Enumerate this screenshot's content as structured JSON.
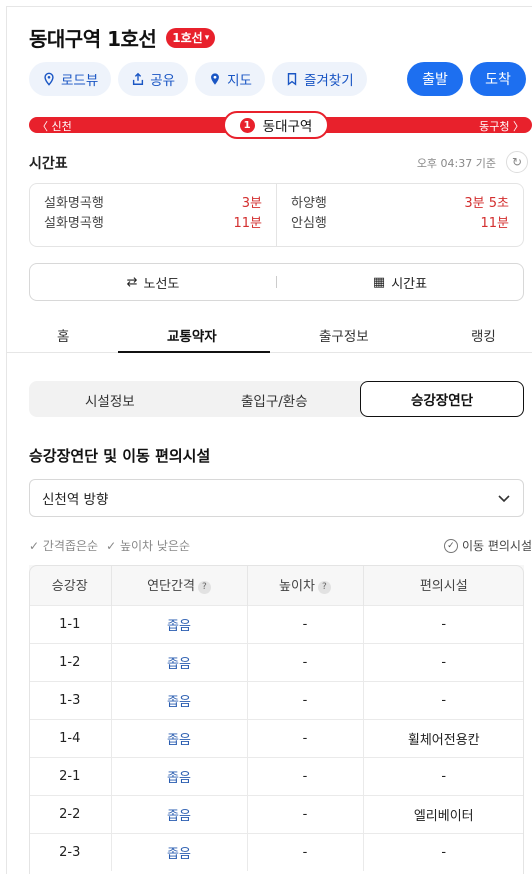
{
  "header": {
    "title": "동대구역 1호선",
    "line_chip": "1호선"
  },
  "actions": {
    "roadview": "로드뷰",
    "share": "공유",
    "map": "지도",
    "favorite": "즐겨찾기",
    "depart": "출발",
    "arrive": "도착"
  },
  "line_bar": {
    "prev": "〈 신천",
    "next": "동구청 〉",
    "line_number": "1",
    "station": "동대구역",
    "color": "#e8212c"
  },
  "timetable": {
    "heading": "시간표",
    "updated": "오후 04:37 기준",
    "left": [
      {
        "dest": "설화명곡행",
        "min": "3분"
      },
      {
        "dest": "설화명곡행",
        "min": "11분"
      }
    ],
    "right": [
      {
        "dest": "하양행",
        "min": "3분 5초"
      },
      {
        "dest": "안심행",
        "min": "11분"
      }
    ],
    "route_map": "노선도",
    "timetable_button": "시간표"
  },
  "main_tabs": [
    "홈",
    "교통약자",
    "출구정보",
    "랭킹"
  ],
  "sub_tabs": [
    "시설정보",
    "출입구/환승",
    "승강장연단"
  ],
  "section": {
    "title": "승강장연단 및 이동 편의시설",
    "direction": "신천역 방향",
    "filter_narrow": "간격좁은순",
    "filter_height": "높이차 낮은순",
    "legend": "이동 편의시설"
  },
  "table": {
    "headers": [
      "승강장",
      "연단간격",
      "높이차",
      "편의시설"
    ],
    "rows": [
      [
        "1-1",
        "좁음",
        "-",
        "-"
      ],
      [
        "1-2",
        "좁음",
        "-",
        "-"
      ],
      [
        "1-3",
        "좁음",
        "-",
        "-"
      ],
      [
        "1-4",
        "좁음",
        "-",
        "휠체어전용칸"
      ],
      [
        "2-1",
        "좁음",
        "-",
        "-"
      ],
      [
        "2-2",
        "좁음",
        "-",
        "엘리베이터"
      ],
      [
        "2-3",
        "좁음",
        "-",
        "-"
      ]
    ]
  }
}
